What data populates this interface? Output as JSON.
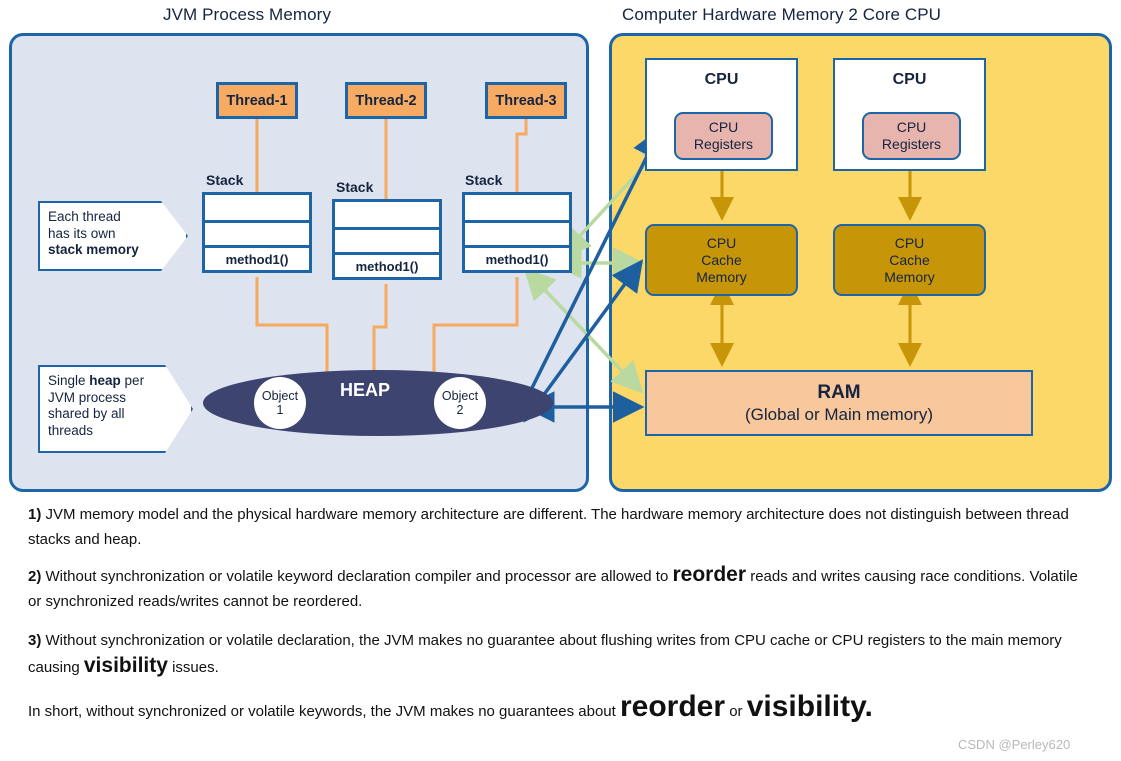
{
  "titles": {
    "jvm": "JVM Process Memory",
    "hardware": "Computer Hardware Memory 2 Core CPU"
  },
  "jvm": {
    "threads": [
      {
        "label": "Thread-1"
      },
      {
        "label": "Thread-2"
      },
      {
        "label": "Thread-3"
      }
    ],
    "stack_label": "Stack",
    "stack_method": "method1()",
    "callout_stack": {
      "line1": "Each thread",
      "line2": "has its own",
      "line3": "stack memory"
    },
    "callout_heap": {
      "line1_pre": "Single ",
      "line1_bold": "heap",
      "line1_post": " per",
      "line2": "JVM process",
      "line3": "shared by all",
      "line4": "threads"
    },
    "heap": {
      "label": "HEAP",
      "objects": [
        {
          "line1": "Object",
          "line2": "1"
        },
        {
          "line1": "Object",
          "line2": "2"
        }
      ]
    }
  },
  "hardware": {
    "cpus": [
      {
        "title": "CPU",
        "registers_line1": "CPU",
        "registers_line2": "Registers",
        "cache_line1": "CPU",
        "cache_line2": "Cache",
        "cache_line3": "Memory"
      },
      {
        "title": "CPU",
        "registers_line1": "CPU",
        "registers_line2": "Registers",
        "cache_line1": "CPU",
        "cache_line2": "Cache",
        "cache_line3": "Memory"
      }
    ],
    "ram": {
      "title": "RAM",
      "subtitle": "(Global or Main memory)"
    }
  },
  "notes": {
    "note1": {
      "number": "1)",
      "text": " JVM memory model and the physical hardware memory architecture are different. The hardware memory architecture does not distinguish between thread stacks and heap."
    },
    "note2": {
      "number": "2)",
      "pre": " Without synchronization or volatile keyword declaration compiler and processor are allowed to ",
      "keyword": "reorder",
      "post": " reads and writes causing race conditions. Volatile or synchronized reads/writes cannot be reordered."
    },
    "note3": {
      "number": "3)",
      "pre": " Without synchronization or volatile declaration, the JVM makes no guarantee about flushing writes from CPU cache or CPU registers to the main memory causing ",
      "keyword": "visibility",
      "post": " issues."
    },
    "note4": {
      "pre": "In short, without synchronized or volatile keywords, the JVM makes no guarantees about ",
      "keyword1": "reorder",
      "mid": " or ",
      "keyword2": "visibility."
    }
  },
  "watermark": "CSDN @Perley620",
  "colors": {
    "panel_border": "#1e65a7",
    "jvm_panel_bg": "#dde3ef",
    "hardware_panel_bg": "#fbd868",
    "thread_fill": "#f7ab62",
    "heap_fill": "#3d4470",
    "registers_fill": "#e8b4ae",
    "cache_fill": "#c79608",
    "ram_fill": "#f8c79c",
    "orange_wire": "#f7aa5d",
    "green_arrow": "#b9d9a0",
    "blue_arrow": "#1e5fa0",
    "gold_arrow": "#c79608"
  }
}
